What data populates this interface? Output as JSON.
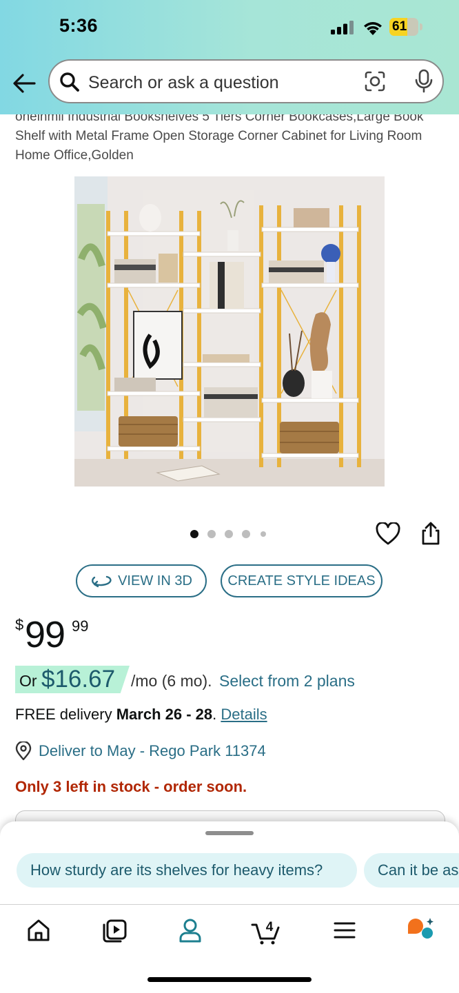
{
  "status_bar": {
    "time": "5:36",
    "battery": "61",
    "battery_level": 0.61
  },
  "search": {
    "placeholder": "Search or ask a question"
  },
  "product": {
    "title": "oneinmil Industrial Bookshelves 5 Tiers Corner Bookcases,Large Book Shelf with Metal Frame Open Storage Corner Cabinet for Living Room Home Office,Golden",
    "image_count": 5,
    "active_image": 0
  },
  "actions": {
    "view_3d": "VIEW IN 3D",
    "style_ideas": "CREATE STYLE IDEAS"
  },
  "price": {
    "currency": "$",
    "whole": "99",
    "fraction": "99"
  },
  "installment": {
    "prefix": "Or",
    "amount": "$16.67",
    "terms": "/mo (6 mo).",
    "plans_link": "Select from 2 plans"
  },
  "delivery": {
    "prefix": "FREE delivery",
    "dates": "March 26 - 28",
    "suffix": ".",
    "details_link": "Details"
  },
  "location": {
    "text": "Deliver to May - Rego Park 11374"
  },
  "stock": {
    "text": "Only 3 left in stock - order soon."
  },
  "suggestions": [
    "How sturdy are its shelves for heavy items?",
    "Can it be as"
  ],
  "tabbar": {
    "cart_count": "4"
  },
  "colors": {
    "accent": "#2a6e86",
    "stock": "#b12704",
    "emi_highlight": "#b8f1d7",
    "header_start": "#82d8e3",
    "header_end": "#a9e6d3"
  }
}
